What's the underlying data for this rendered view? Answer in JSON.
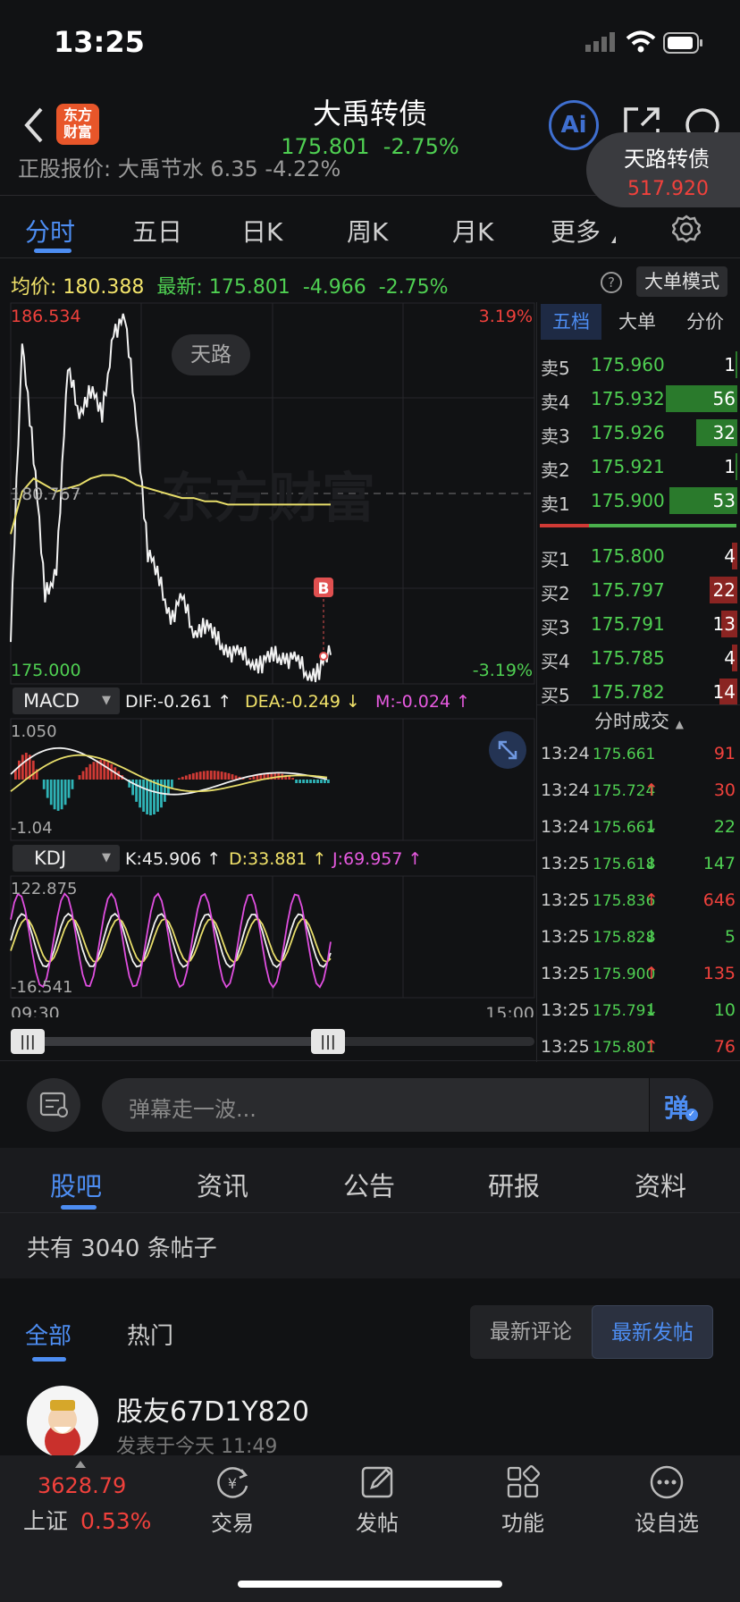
{
  "status_bar": {
    "time": "13:25"
  },
  "header": {
    "title": "大禹转债",
    "price": "175.801",
    "change": "-2.75%",
    "logo_text": "东方财富",
    "ai_label": "Ai"
  },
  "underlying": {
    "text": "正股报价: 大禹节水 6.35 -4.22%"
  },
  "popup": {
    "title": "天路转债",
    "price": "517.920"
  },
  "chart_tabs": [
    "分时",
    "五日",
    "日K",
    "周K",
    "月K",
    "更多"
  ],
  "summary": {
    "avg_label": "均价:",
    "avg_value": "180.388",
    "latest_label": "最新:",
    "latest_value": "175.801",
    "change_value": "-4.966",
    "change_pct": "-2.75%",
    "mode": "大单模式"
  },
  "chart": {
    "y_top": "186.534",
    "y_mid": "180.767",
    "y_bottom": "175.000",
    "pct_top": "3.19%",
    "pct_bottom": "-3.19%",
    "tag": "天路",
    "watermark": "东方财富",
    "marker": "B",
    "time_start": "09:30",
    "time_end": "15:00"
  },
  "chart_data": [
    {
      "type": "line",
      "title": "",
      "x_range": [
        "09:30",
        "13:25"
      ],
      "ylim": [
        175.0,
        186.534
      ],
      "series": [
        {
          "name": "",
          "values": [
            176.2,
            185.5,
            182.0,
            177.5,
            178.5,
            184.5,
            183.2,
            184.0,
            183.0,
            185.8,
            186.0,
            183.0,
            179.0,
            178.0,
            177.0,
            177.5,
            176.5,
            176.8,
            176.2,
            176.0,
            175.8,
            175.6,
            175.6,
            175.7,
            175.8,
            175.6,
            175.2,
            175.4,
            175.8
          ]
        },
        {
          "name": "",
          "values": [
            179.5,
            180.8,
            181.2,
            181.0,
            180.8,
            180.9,
            181.0,
            181.2,
            181.3,
            181.3,
            181.2,
            181.0,
            180.9,
            180.8,
            180.7,
            180.6,
            180.6,
            180.5,
            180.5,
            180.4,
            180.4,
            180.4,
            180.4,
            180.4,
            180.4,
            180.4,
            180.4,
            180.4,
            180.4
          ]
        }
      ]
    },
    {
      "type": "bar",
      "title": "MACD",
      "ylim": [
        -1.04,
        1.05
      ],
      "series": [
        {
          "name": "DIF",
          "values": [
            -0.261
          ]
        },
        {
          "name": "DEA",
          "values": [
            -0.249
          ]
        },
        {
          "name": "M",
          "values": [
            -0.024
          ]
        }
      ]
    },
    {
      "type": "line",
      "title": "KDJ",
      "ylim": [
        -16.541,
        122.875
      ],
      "series": [
        {
          "name": "K",
          "values": [
            45.906
          ]
        },
        {
          "name": "D",
          "values": [
            33.881
          ]
        },
        {
          "name": "J",
          "values": [
            69.957
          ]
        }
      ]
    }
  ],
  "macd": {
    "label": "MACD",
    "dif": "DIF:-0.261 ↑",
    "dea": "DEA:-0.249 ↓",
    "m": "M:-0.024 ↑",
    "top": "1.050",
    "bottom": "-1.04"
  },
  "kdj": {
    "label": "KDJ",
    "k": "K:45.906 ↑",
    "d": "D:33.881 ↑",
    "j": "J:69.957 ↑",
    "top": "122.875",
    "bottom": "-16.541"
  },
  "book_tabs": [
    "五档",
    "大单",
    "分价"
  ],
  "asks": [
    {
      "label": "卖5",
      "price": "175.960",
      "vol": "1",
      "fill": 0.02
    },
    {
      "label": "卖4",
      "price": "175.932",
      "vol": "56",
      "fill": 1.0
    },
    {
      "label": "卖3",
      "price": "175.926",
      "vol": "32",
      "fill": 0.57
    },
    {
      "label": "卖2",
      "price": "175.921",
      "vol": "1",
      "fill": 0.02
    },
    {
      "label": "卖1",
      "price": "175.900",
      "vol": "53",
      "fill": 0.95
    }
  ],
  "bids": [
    {
      "label": "买1",
      "price": "175.800",
      "vol": "4",
      "fill": 0.07
    },
    {
      "label": "买2",
      "price": "175.797",
      "vol": "22",
      "fill": 0.39
    },
    {
      "label": "买3",
      "price": "175.791",
      "vol": "13",
      "fill": 0.23
    },
    {
      "label": "买4",
      "price": "175.785",
      "vol": "4",
      "fill": 0.07
    },
    {
      "label": "买5",
      "price": "175.782",
      "vol": "14",
      "fill": 0.25
    }
  ],
  "trades_title": "分时成交",
  "trades": [
    {
      "time": "13:24",
      "price": "175.661",
      "vol": "91",
      "dir": ""
    },
    {
      "time": "13:24",
      "price": "175.724",
      "vol": "30",
      "dir": "up"
    },
    {
      "time": "13:24",
      "price": "175.661",
      "vol": "22",
      "dir": "down"
    },
    {
      "time": "13:25",
      "price": "175.618",
      "vol": "147",
      "dir": "down"
    },
    {
      "time": "13:25",
      "price": "175.836",
      "vol": "646",
      "dir": "up"
    },
    {
      "time": "13:25",
      "price": "175.828",
      "vol": "5",
      "dir": "down"
    },
    {
      "time": "13:25",
      "price": "175.900",
      "vol": "135",
      "dir": "up"
    },
    {
      "time": "13:25",
      "price": "175.791",
      "vol": "10",
      "dir": "down"
    },
    {
      "time": "13:25",
      "price": "175.801",
      "vol": "76",
      "dir": "up"
    }
  ],
  "danmu": {
    "placeholder": "弹幕走一波...",
    "send": "弹"
  },
  "info_tabs": [
    "股吧",
    "资讯",
    "公告",
    "研报",
    "资料"
  ],
  "post_count": "共有 3040 条帖子",
  "filter_tabs": [
    "全部",
    "热门"
  ],
  "sort_options": [
    "最新评论",
    "最新发帖"
  ],
  "post": {
    "author": "股友67D1Y820",
    "time": "发表于今天 11:49"
  },
  "bottom_nav": {
    "index_value": "3628.79",
    "index_name": "上证",
    "index_change": "0.53%",
    "items": [
      "交易",
      "发帖",
      "功能",
      "设自选"
    ]
  }
}
